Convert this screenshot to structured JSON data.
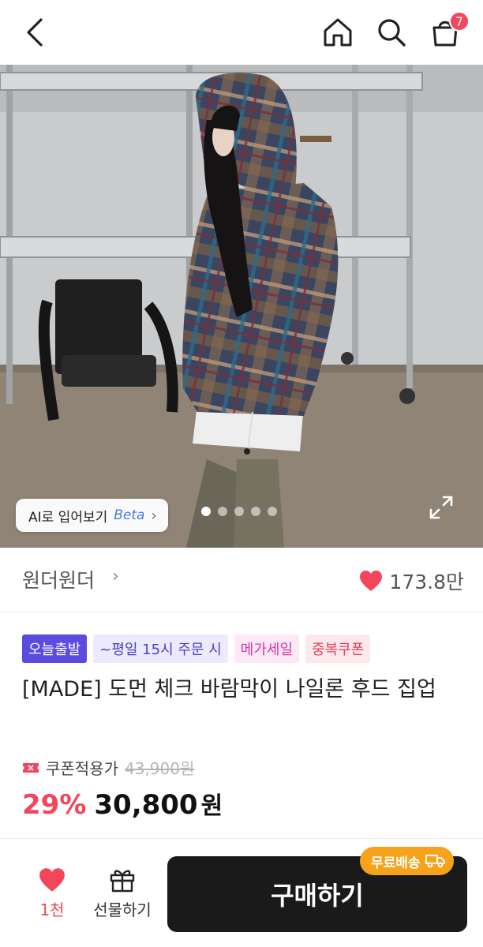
{
  "header": {
    "back_icon": "chevron-left-icon",
    "home_icon": "home-icon",
    "search_icon": "search-icon",
    "cart_icon": "shopping-bag-icon",
    "cart_count": "7"
  },
  "hero": {
    "ai_try_label": "AI로 입어보기",
    "ai_try_badge": "Beta",
    "ai_try_chevron": "›",
    "carousel_total": 5,
    "carousel_active": 1
  },
  "seller": {
    "name": "원더원더",
    "chevron": "›",
    "like_count": "173.8만"
  },
  "product": {
    "tags": [
      "오늘출발",
      "~평일 15시 주문 시",
      "메가세일",
      "중복쿠폰"
    ],
    "title": "[MADE] 도먼 체크 바람막이 나일론 후드 집업",
    "coupon_label": "쿠폰적용가",
    "original_price": "43,900원",
    "discount": "29%",
    "price": "30,800",
    "price_unit": "원"
  },
  "bottom_bar": {
    "like_count": "1천",
    "gift_label": "선물하기",
    "buy_label": "구매하기",
    "free_shipping_label": "무료배송"
  },
  "colors": {
    "accent": "#f3465c",
    "buy_button": "#1a1a1a",
    "free_shipping": "#f7a21b"
  }
}
